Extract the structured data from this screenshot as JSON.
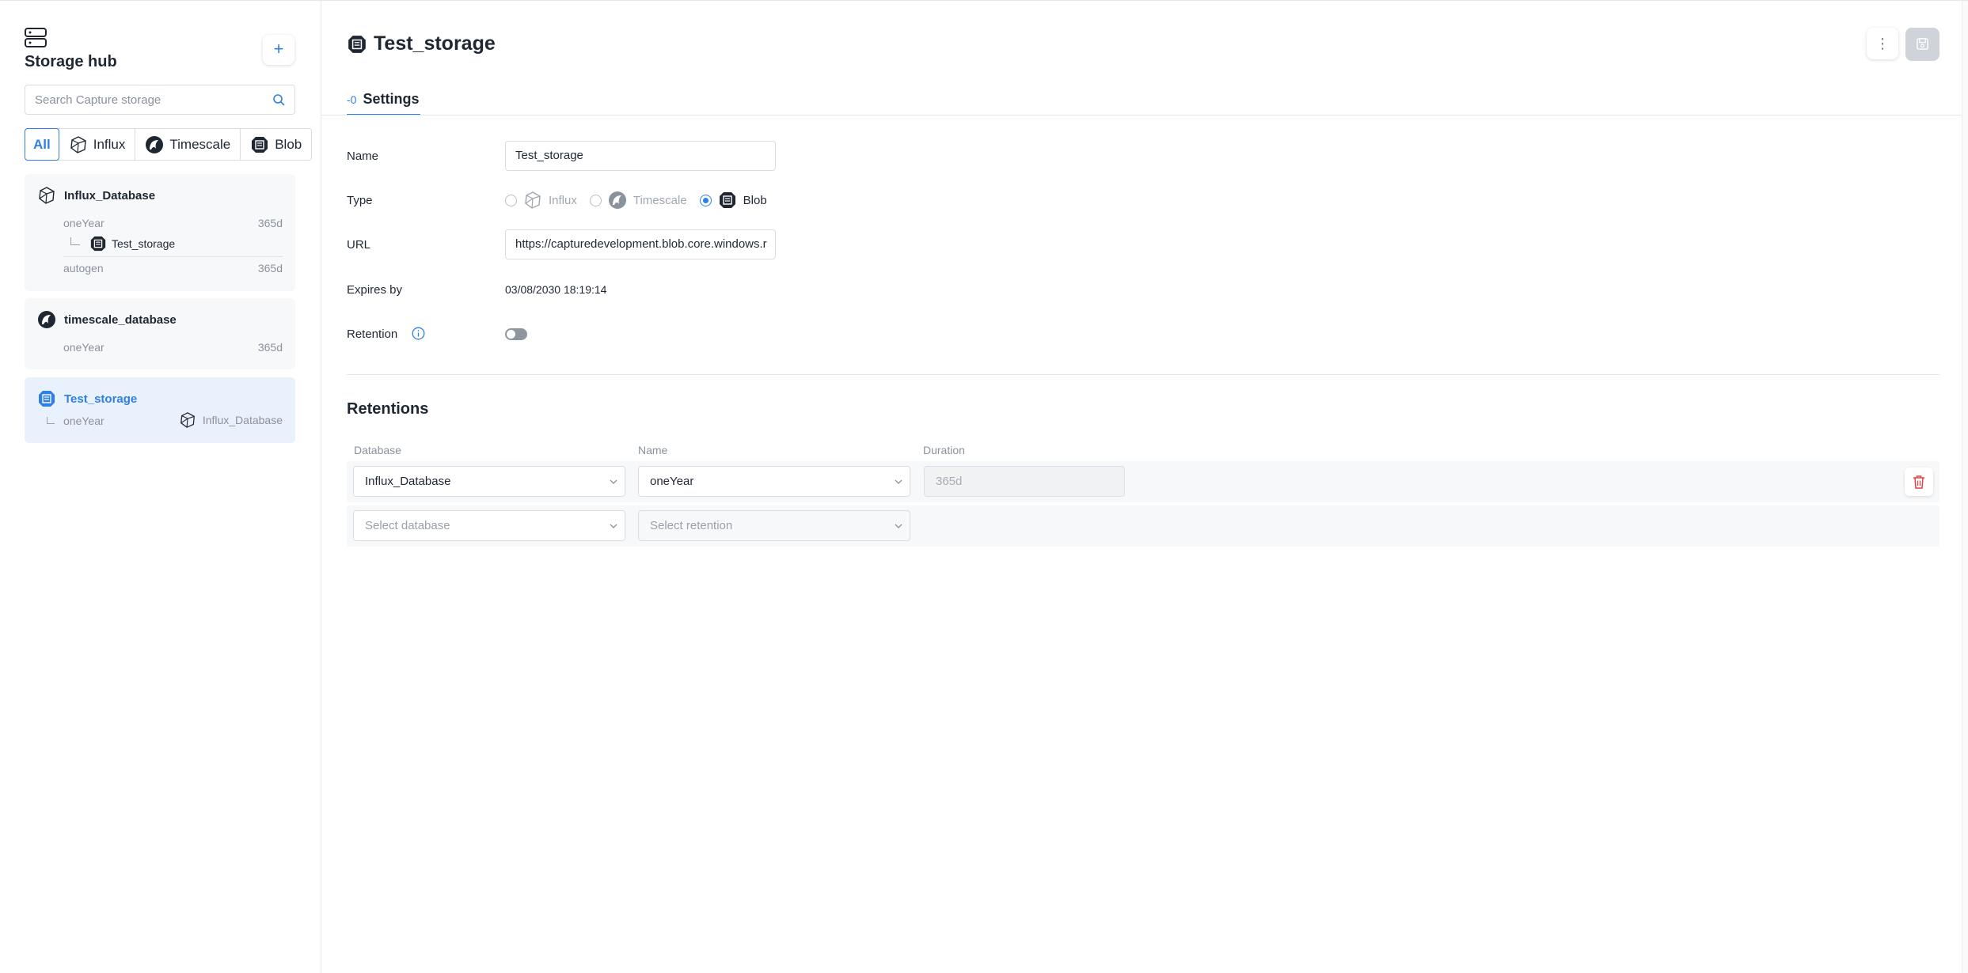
{
  "sidebar": {
    "title": "Storage hub",
    "add_label": "+",
    "search": {
      "placeholder": "Search Capture storage",
      "value": ""
    },
    "filters": [
      {
        "label": "All",
        "active": true
      },
      {
        "label": "Influx",
        "icon": "influx-icon"
      },
      {
        "label": "Timescale",
        "icon": "timescale-icon"
      },
      {
        "label": "Blob",
        "icon": "blob-icon"
      }
    ],
    "cards": [
      {
        "title": "Influx_Database",
        "icon": "influx-icon",
        "retentions": [
          {
            "name": "oneYear",
            "duration": "365d",
            "child": "Test_storage"
          },
          {
            "name": "autogen",
            "duration": "365d"
          }
        ]
      },
      {
        "title": "timescale_database",
        "icon": "timescale-icon",
        "retentions": [
          {
            "name": "oneYear",
            "duration": "365d"
          }
        ]
      },
      {
        "title": "Test_storage",
        "icon": "blob-icon",
        "selected": true,
        "retentions": [
          {
            "name": "oneYear",
            "linked": "Influx_Database"
          }
        ]
      }
    ]
  },
  "main": {
    "title": "Test_storage",
    "kebab_label": "⋮",
    "tab": {
      "label": "Settings",
      "icon_text": "-0"
    },
    "form": {
      "name_label": "Name",
      "name_value": "Test_storage",
      "type_label": "Type",
      "types": [
        "Influx",
        "Timescale",
        "Blob"
      ],
      "selected_type": "Blob",
      "url_label": "URL",
      "url_value": "https://capturedevelopment.blob.core.windows.r",
      "expires_label": "Expires by",
      "expires_value": "03/08/2030 18:19:14",
      "retention_label": "Retention",
      "retention_enabled": false
    },
    "retentions": {
      "title": "Retentions",
      "headers": {
        "database": "Database",
        "name": "Name",
        "duration": "Duration"
      },
      "rows": [
        {
          "database": "Influx_Database",
          "name": "oneYear",
          "duration": "365d"
        }
      ],
      "new_row": {
        "database_placeholder": "Select database",
        "retention_placeholder": "Select retention"
      }
    }
  },
  "colors": {
    "accent": "#2f7fe5",
    "danger": "#e04343",
    "text": "#1f2733",
    "muted": "#8a929c"
  }
}
